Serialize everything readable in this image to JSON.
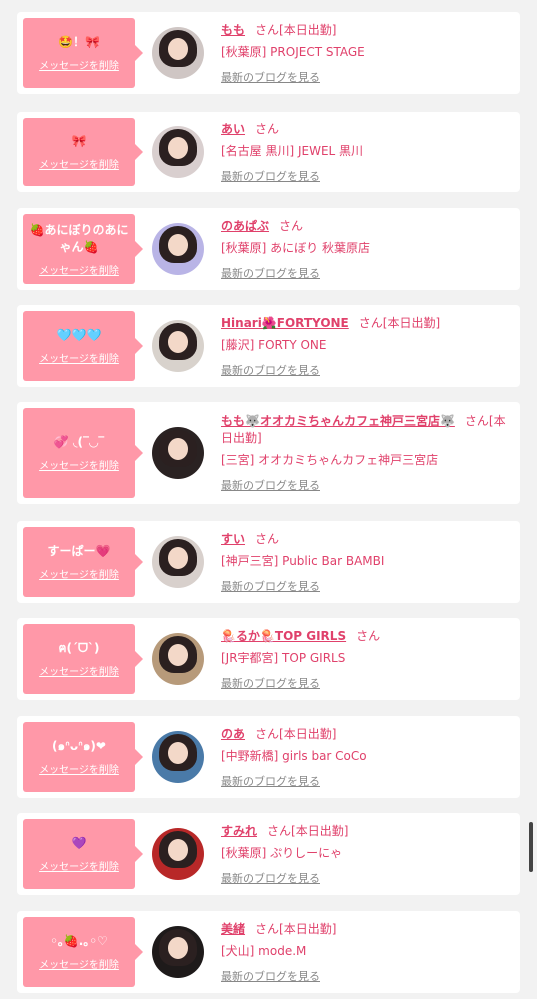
{
  "cards": [
    {
      "bubble": "🤩！🎀",
      "delete": "メッセージを削除",
      "name": "もも",
      "suffix": "さん[本日出勤]",
      "shop": "[秋葉原] PROJECT STAGE",
      "blog": "最新のブログを見る",
      "avatar_bg": "#cfc6c4"
    },
    {
      "bubble": "🎀",
      "delete": "メッセージを削除",
      "name": "あい",
      "suffix": "さん",
      "shop": "[名古屋 黒川] JEWEL 黒川",
      "blog": "最新のブログを見る",
      "avatar_bg": "#d9cfcf"
    },
    {
      "bubble": "🍓あにぼりのあにゃん🍓",
      "delete": "メッセージを削除",
      "name": "のあぱぶ",
      "suffix": "さん",
      "shop": "[秋葉原] あにぼり 秋葉原店",
      "blog": "最新のブログを見る",
      "avatar_bg": "#b9b4e6"
    },
    {
      "bubble": "🩵🩵🩵",
      "delete": "メッセージを削除",
      "name": "Hinari🌺FORTYONE",
      "suffix": "さん[本日出勤]",
      "shop": "[藤沢] FORTY ONE",
      "blog": "最新のブログを見る",
      "avatar_bg": "#d8d2cc"
    },
    {
      "bubble": "💞 ◟(‾◡‾",
      "delete": "メッセージを削除",
      "name": "もも🐺オオカミちゃんカフェ神戸三宮店🐺",
      "suffix": "さん[本日出勤]",
      "shop": "[三宮] オオカミちゃんカフェ神戸三宮店",
      "blog": "最新のブログを見る",
      "avatar_bg": "#2a2222"
    },
    {
      "bubble": "すーぱー💗",
      "delete": "メッセージを削除",
      "name": "すい",
      "suffix": "さん",
      "shop": "[神戸三宮] Public Bar BAMBI",
      "blog": "最新のブログを見る",
      "avatar_bg": "#d8d0cc"
    },
    {
      "bubble": "ฅ(ˊᗜˋ)",
      "delete": "メッセージを削除",
      "name": "🪼るか🪼TOP GIRLS",
      "suffix": "さん",
      "shop": "[JR宇都宮] TOP GIRLS",
      "blog": "最新のブログを見る",
      "avatar_bg": "#b79a7a"
    },
    {
      "bubble": "(๑ᐢᴗᐢ๑)❤︎",
      "delete": "メッセージを削除",
      "name": "のあ",
      "suffix": "さん[本日出勤]",
      "shop": "[中野新橋] girls bar CoCo",
      "blog": "最新のブログを見る",
      "avatar_bg": "#4a7aa8"
    },
    {
      "bubble": "💜",
      "delete": "メッセージを削除",
      "name": "すみれ",
      "suffix": "さん[本日出勤]",
      "shop": "[秋葉原] ぷりしーにゃ",
      "blog": "最新のブログを見る",
      "avatar_bg": "#b82828"
    },
    {
      "bubble": "◦｡🍓.｡◦♡",
      "delete": "メッセージを削除",
      "name": "美緒",
      "suffix": "さん[本日出勤]",
      "shop": "[犬山] mode.M",
      "blog": "最新のブログを見る",
      "avatar_bg": "#1e1a1a"
    }
  ]
}
